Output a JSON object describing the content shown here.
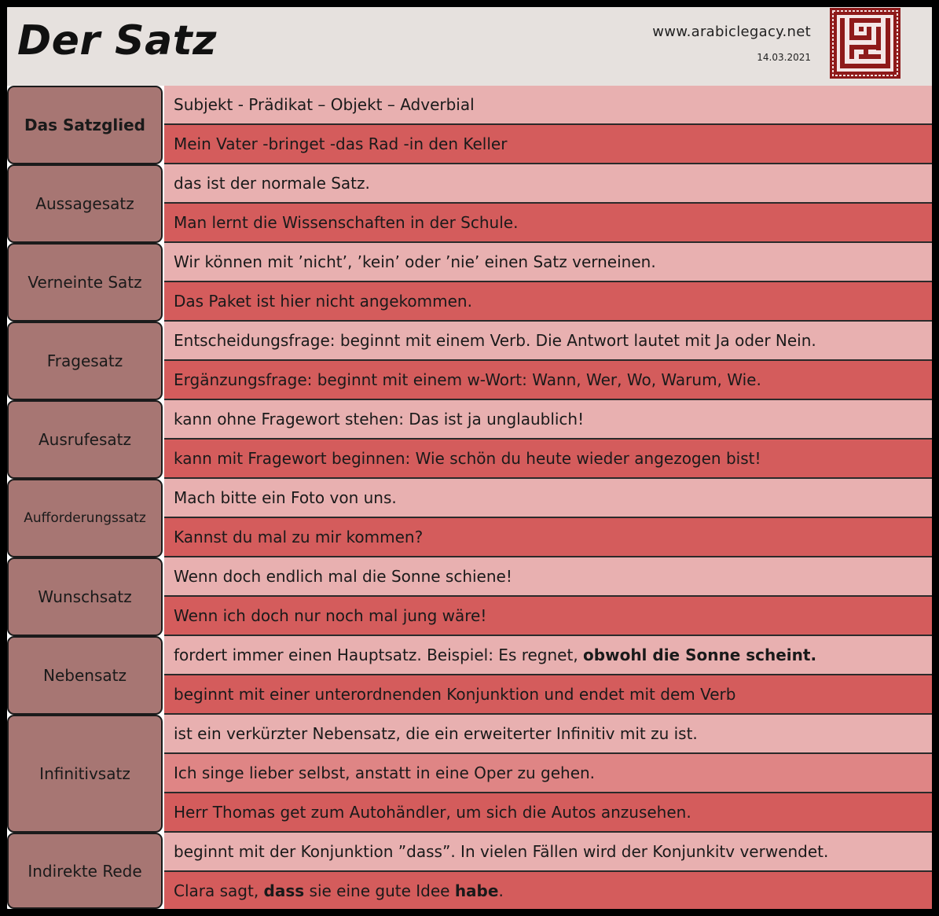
{
  "header": {
    "title": "Der Satz",
    "website": "www.arabiclegacy.net",
    "date": "14.03.2021",
    "logo_icon": "arabic-calligraphy-square-logo"
  },
  "colors": {
    "header_bg": "#e6e1de",
    "label_bg": "#a77673",
    "row_light": "#e8b0b0",
    "row_dark": "#d45c5c",
    "row_mid": "#df8585",
    "logo_red": "#8e1a1a"
  },
  "groups": [
    {
      "label": "Das Satzglied",
      "rows": [
        "Subjekt - Prädikat – Objekt – Adverbial",
        "Mein Vater -bringet -das Rad -in den Keller"
      ]
    },
    {
      "label": "Aussagesatz",
      "rows": [
        "das ist der normale Satz.",
        "Man lernt die Wissenschaften in der Schule."
      ]
    },
    {
      "label": "Verneinte Satz",
      "rows": [
        "Wir können mit ’nicht’, ’kein’ oder ’nie’ einen Satz verneinen.",
        "Das Paket ist hier nicht angekommen."
      ]
    },
    {
      "label": "Fragesatz",
      "rows": [
        "Entscheidungsfrage: beginnt mit einem Verb. Die Antwort lautet mit Ja oder Nein.",
        "Ergänzungsfrage: beginnt mit einem w-Wort: Wann, Wer, Wo, Warum, Wie."
      ]
    },
    {
      "label": "Ausrufesatz",
      "rows": [
        "kann ohne Fragewort stehen: Das ist ja unglaublich!",
        "kann mit Fragewort beginnen: Wie schön du heute wieder angezogen bist!"
      ]
    },
    {
      "label": "Aufforderungssatz",
      "rows": [
        "Mach bitte ein Foto von uns.",
        "Kannst du mal zu mir kommen?"
      ]
    },
    {
      "label": "Wunschsatz",
      "rows": [
        "Wenn doch endlich mal die Sonne schiene!",
        "Wenn ich doch nur noch mal jung wäre!"
      ]
    },
    {
      "label": "Nebensatz",
      "rows": [
        {
          "plain": "fordert immer einen Hauptsatz. Beispiel: Es regnet, ",
          "bold": "obwohl die Sonne scheint."
        },
        "beginnt mit einer unterordnenden Konjunktion und endet mit dem Verb"
      ]
    },
    {
      "label": "Infinitivsatz",
      "rows": [
        "ist ein verkürzter Nebensatz, die ein erweiterter Infinitiv mit zu ist.",
        "Ich singe lieber selbst, anstatt in eine Oper zu gehen.",
        "Herr Thomas get zum Autohändler, um sich die Autos anzusehen."
      ]
    },
    {
      "label": "Indirekte Rede",
      "rows": [
        "beginnt mit der Konjunktion ”dass”. In vielen Fällen wird der Konjunkitv verwendet.",
        {
          "p1": "Clara sagt, ",
          "b1": "dass",
          "p2": " sie eine gute Idee ",
          "b2": "habe",
          "p3": "."
        }
      ]
    }
  ]
}
